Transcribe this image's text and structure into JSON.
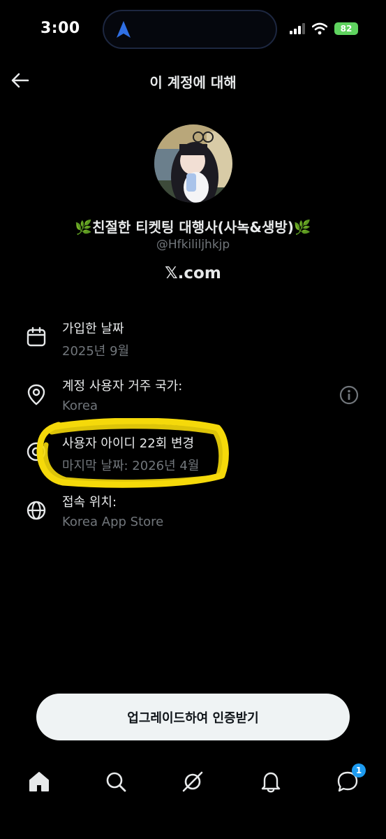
{
  "status_bar": {
    "time": "3:00",
    "battery": "82"
  },
  "header": {
    "title": "이 계정에 대해"
  },
  "profile": {
    "leaf_icon": "🌿",
    "display_name": "친절한 티켓팅 대행사(사녹&생방)",
    "handle": "@Hfkililjhkjp",
    "site": "𝕏.com"
  },
  "info": [
    {
      "icon": "calendar-icon",
      "label": "가입한 날짜",
      "value": "2025년 9월"
    },
    {
      "icon": "location-pin-icon",
      "label": "계정 사용자 거주 국가:",
      "value": "Korea"
    },
    {
      "icon": "at-sign-icon",
      "label": "사용자 아이디 22회 변경",
      "value": "마지막 날짜: 2026년 4월"
    },
    {
      "icon": "globe-icon",
      "label": "접속 위치:",
      "value": "Korea App Store"
    }
  ],
  "upgrade": {
    "label": "업그레이드하여 인증받기"
  },
  "nav": {
    "messages_badge": "1"
  },
  "colors": {
    "background": "#000000",
    "primary_text": "#e7e9ea",
    "secondary_text": "#71767b",
    "accent": "#1d9bf0",
    "highlight": "#f5d90a"
  }
}
